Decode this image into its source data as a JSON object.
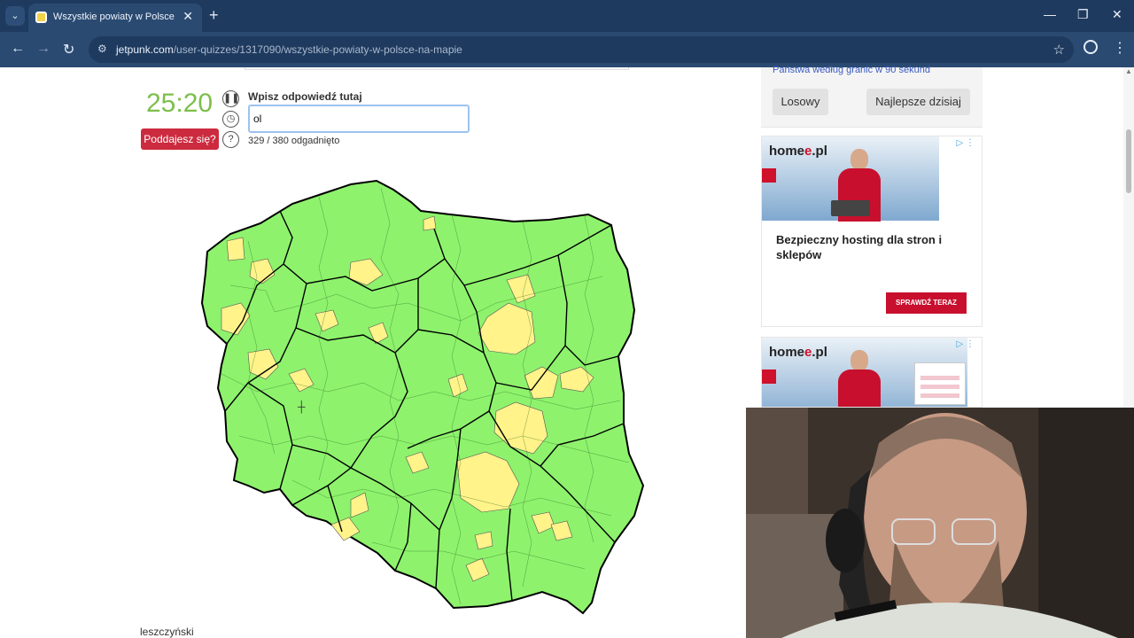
{
  "browser": {
    "tab_title": "Wszystkie powiaty w Polsce na",
    "new_tab_symbol": "+",
    "url_host": "jetpunk.com",
    "url_path": "/user-quizzes/1317090/wszystkie-powiaty-w-polsce-na-mapie"
  },
  "quiz": {
    "timer": "25:20",
    "answer_label": "Wpisz odpowiedź tutaj",
    "answer_value": "ol",
    "give_up_label": "Poddajesz się?",
    "progress_text": "329 / 380 odgadnięto",
    "hover_label": "leszczyński"
  },
  "map": {
    "guessed_color": "#8ef26d",
    "missing_color": "#fff38a",
    "border_color": "#000000"
  },
  "sidebar": {
    "link_text": "Państwa według granic w 90 sekund",
    "random_button": "Losowy",
    "best_today_button": "Najlepsze dzisiaj"
  },
  "ads": [
    {
      "logo_main": "home",
      "logo_accent": "e",
      "logo_suffix": ".pl",
      "headline": "Bezpieczny hosting dla stron i sklepów",
      "cta": "SPRAWDŹ TERAZ"
    },
    {
      "logo_main": "home",
      "logo_accent": "e",
      "logo_suffix": ".pl"
    }
  ]
}
